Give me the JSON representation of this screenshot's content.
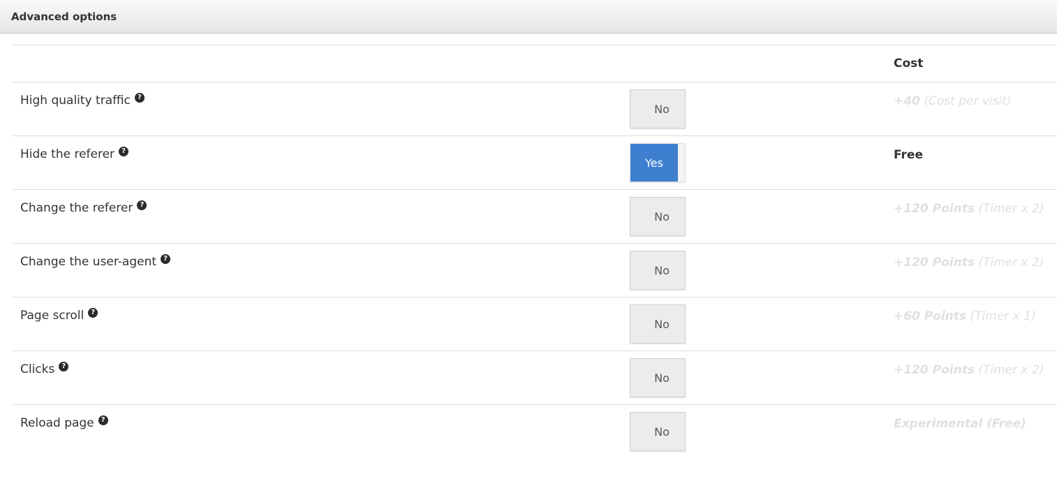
{
  "panel": {
    "title": "Advanced options"
  },
  "table": {
    "cost_header": "Cost",
    "rows": [
      {
        "label": "High quality traffic",
        "toggle": "No",
        "cost_strong": "+40",
        "cost_note": "(Cost per visit)"
      },
      {
        "label": "Hide the referer",
        "toggle": "Yes",
        "cost_strong": "Free",
        "cost_note": ""
      },
      {
        "label": "Change the referer",
        "toggle": "No",
        "cost_strong": "+120 Points",
        "cost_note": "(Timer x 2)"
      },
      {
        "label": "Change the user-agent",
        "toggle": "No",
        "cost_strong": "+120 Points",
        "cost_note": "(Timer x 2)"
      },
      {
        "label": "Page scroll",
        "toggle": "No",
        "cost_strong": "+60 Points",
        "cost_note": "(Timer x 1)"
      },
      {
        "label": "Clicks",
        "toggle": "No",
        "cost_strong": "+120 Points",
        "cost_note": "(Timer x 2)"
      },
      {
        "label": "Reload page",
        "toggle": "No",
        "cost_strong": "Experimental (Free)",
        "cost_note": ""
      }
    ]
  },
  "icons": {
    "help": "question-circle-icon"
  },
  "colors": {
    "toggle_on": "#3f7fd0",
    "toggle_off": "#ececec",
    "cost_disabled": "#e0e0e0",
    "cost_active": "#333333"
  }
}
